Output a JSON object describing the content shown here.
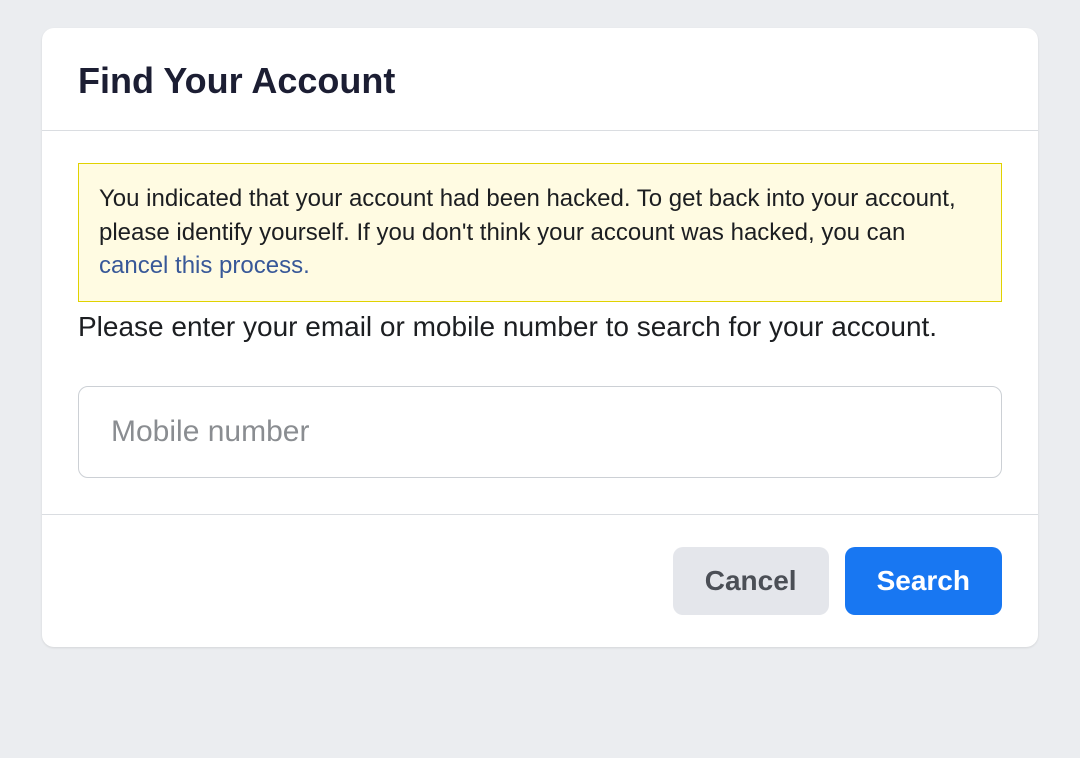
{
  "card": {
    "title": "Find Your Account",
    "alert": {
      "text_before": "You indicated that your account had been hacked. To get back into your account, please identify yourself. If you don't think your account was hacked, you can ",
      "link_text": "cancel this process."
    },
    "instruction": "Please enter your email or mobile number to search for your account.",
    "input": {
      "placeholder": "Mobile number",
      "value": ""
    },
    "buttons": {
      "cancel": "Cancel",
      "search": "Search"
    }
  }
}
